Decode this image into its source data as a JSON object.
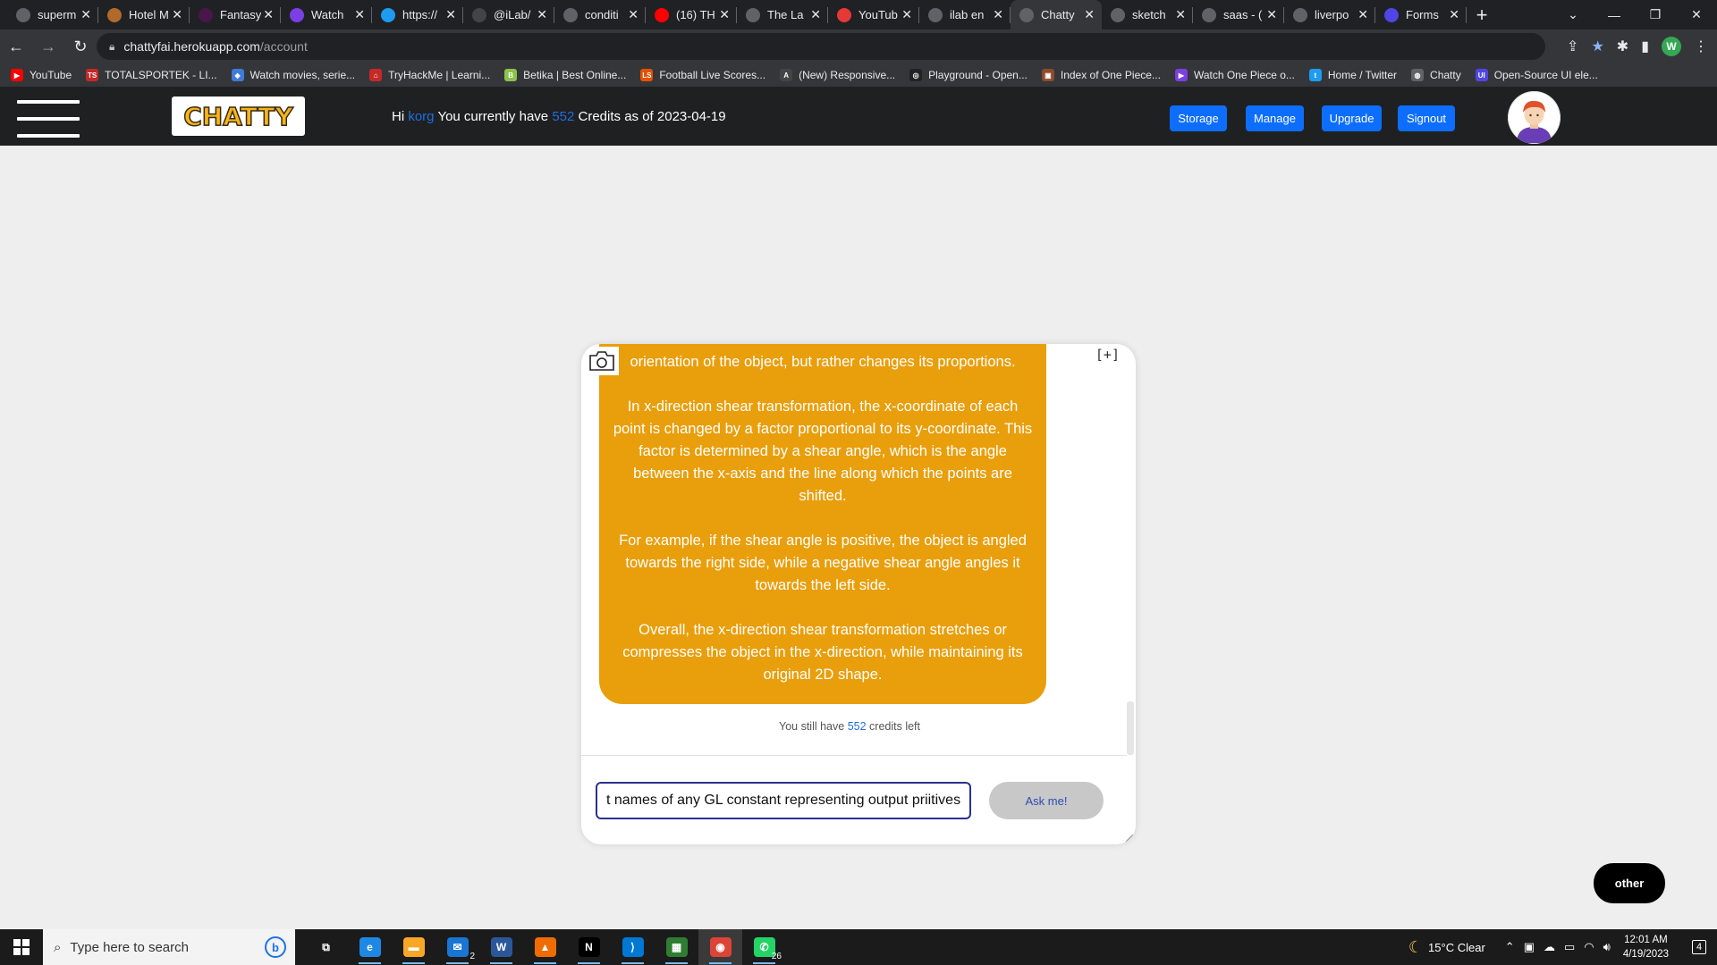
{
  "browser": {
    "tabs": [
      {
        "label": "superm",
        "color": "#5f6368"
      },
      {
        "label": "Hotel M",
        "color": "#b06a2a"
      },
      {
        "label": "Fantasy",
        "color": "#4a154b"
      },
      {
        "label": "Watch",
        "color": "#7b3fe4"
      },
      {
        "label": "https://",
        "color": "#1d9bf0"
      },
      {
        "label": "@iLab/",
        "color": "#444444"
      },
      {
        "label": "conditi",
        "color": "#5f6368"
      },
      {
        "label": "(16) TH",
        "color": "#ff0000"
      },
      {
        "label": "The La",
        "color": "#5f6368"
      },
      {
        "label": "YouTub",
        "color": "#e53935"
      },
      {
        "label": "ilab en",
        "color": "#5f6368"
      },
      {
        "label": "Chatty",
        "color": "#5f6368",
        "active": true
      },
      {
        "label": "sketch",
        "color": "#5f6368"
      },
      {
        "label": "saas - (",
        "color": "#5f6368"
      },
      {
        "label": "liverpo",
        "color": "#5f6368"
      },
      {
        "label": "Forms",
        "color": "#4f46e5"
      }
    ],
    "url_host": "chattyfai.herokuapp.com",
    "url_path": "/account",
    "profile_initial": "W",
    "bookmarks": [
      {
        "label": "YouTube",
        "color": "#ff0000",
        "glyph": "▶"
      },
      {
        "label": "TOTALSPORTEK - LI...",
        "color": "#c62828",
        "glyph": "TS"
      },
      {
        "label": "Watch movies, serie...",
        "color": "#3f7bd8",
        "glyph": "◈"
      },
      {
        "label": "TryHackMe | Learni...",
        "color": "#c62828",
        "glyph": "⌂"
      },
      {
        "label": "Betika | Best Online...",
        "color": "#8bc34a",
        "glyph": "B"
      },
      {
        "label": "Football Live Scores...",
        "color": "#e65100",
        "glyph": "LS"
      },
      {
        "label": "(New) Responsive...",
        "color": "#444444",
        "glyph": "A"
      },
      {
        "label": "Playground - Open...",
        "color": "#222222",
        "glyph": "◎"
      },
      {
        "label": "Index of One Piece...",
        "color": "#8d4b2b",
        "glyph": "▣"
      },
      {
        "label": "Watch One Piece o...",
        "color": "#7b3fe4",
        "glyph": "▶"
      },
      {
        "label": "Home / Twitter",
        "color": "#1d9bf0",
        "glyph": "t"
      },
      {
        "label": "Chatty",
        "color": "#5f6368",
        "glyph": "◍"
      },
      {
        "label": "Open-Source UI ele...",
        "color": "#4f46e5",
        "glyph": "UI"
      }
    ]
  },
  "app": {
    "logo_text": "CHATTY",
    "greeting": {
      "prefix": "Hi",
      "username": "korg",
      "middle": "You currently have",
      "credits": "552",
      "suffix": "Credits as of 2023-04-19"
    },
    "nav_buttons": [
      "Storage",
      "Manage",
      "Upgrade",
      "Signout"
    ]
  },
  "chat": {
    "expand_label": "[+]",
    "response_paragraphs": [
      "orientation of the object, but rather changes its proportions.",
      "In x-direction shear transformation, the x-coordinate of each point is changed by a factor proportional to its y-coordinate. This factor is determined by a shear angle, which is the angle between the x-axis and the line along which the points are shifted.",
      "For example, if the shear angle is positive, the object is angled towards the right side, while a negative shear angle angles it towards the left side.",
      "Overall, the x-direction shear transformation stretches or compresses the object in the x-direction, while maintaining its original 2D shape."
    ],
    "credits_left_prefix": "You still have",
    "credits_left_value": "552",
    "credits_left_suffix": "credits left",
    "input_value": "t names of any GL constant representing output priitives",
    "ask_button": "Ask me!",
    "bubble_color": "#e99e0c"
  },
  "other_button": "other",
  "taskbar": {
    "search_placeholder": "Type here to search",
    "apps": [
      {
        "name": "task-view",
        "glyph": "⧉",
        "color": "#1b1b1b"
      },
      {
        "name": "edge",
        "glyph": "e",
        "color": "#1e88e5"
      },
      {
        "name": "file-explorer",
        "glyph": "▬",
        "color": "#f9a825"
      },
      {
        "name": "mail",
        "glyph": "✉",
        "color": "#1976d2",
        "badge": "2"
      },
      {
        "name": "word",
        "glyph": "W",
        "color": "#2b579a"
      },
      {
        "name": "vlc",
        "glyph": "▲",
        "color": "#ef6c00"
      },
      {
        "name": "netflix",
        "glyph": "N",
        "color": "#000000"
      },
      {
        "name": "vscode",
        "glyph": "⟩",
        "color": "#0078d4"
      },
      {
        "name": "sheets",
        "glyph": "▦",
        "color": "#2e7d32"
      },
      {
        "name": "chrome",
        "glyph": "◉",
        "color": "#db4437",
        "active": true
      },
      {
        "name": "whatsapp",
        "glyph": "✆",
        "color": "#25d366",
        "badge": "26"
      }
    ],
    "weather": "15°C Clear",
    "time": "12:01 AM",
    "date": "4/19/2023",
    "notifications": "4"
  }
}
